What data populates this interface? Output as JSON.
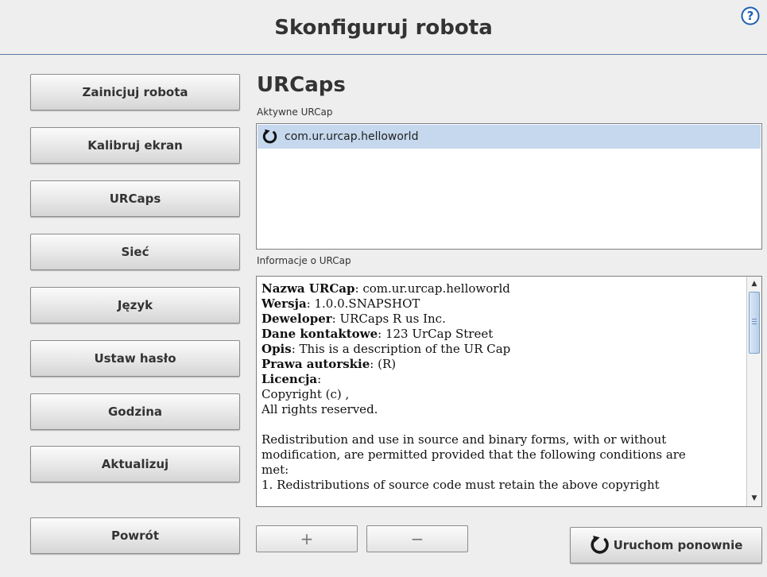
{
  "header": {
    "title": "Skonfiguruj robota",
    "help_icon": "question-mark-circle-icon",
    "help_glyph": "?"
  },
  "nav": {
    "items": [
      {
        "label": "Zainicjuj robota"
      },
      {
        "label": "Kalibruj ekran"
      },
      {
        "label": "URCaps"
      },
      {
        "label": "Sieć"
      },
      {
        "label": "Język"
      },
      {
        "label": "Ustaw hasło"
      },
      {
        "label": "Godzina"
      },
      {
        "label": "Aktualizuj"
      }
    ],
    "back_label": "Powrót"
  },
  "main": {
    "heading": "URCaps",
    "active_label": "Aktywne URCap",
    "active_urcaps": [
      {
        "name": "com.ur.urcap.helloworld",
        "icon": "restart-pending-icon"
      }
    ],
    "info_label": "Informacje o URCap",
    "info": {
      "name_key": "Nazwa URCap",
      "name_val": "com.ur.urcap.helloworld",
      "version_key": "Wersja",
      "version_val": "1.0.0.SNAPSHOT",
      "developer_key": "Deweloper",
      "developer_val": "URCaps R us Inc.",
      "contact_key": "Dane kontaktowe",
      "contact_val": "123 UrCap Street",
      "description_key": "Opis",
      "description_val": "This is a description of the UR Cap",
      "copyright_key": "Prawa autorskie",
      "copyright_val": "(R)",
      "license_key": "Licencja",
      "license_lines": [
        "Copyright (c) ,",
        "All rights reserved.",
        "",
        "Redistribution and use in source and binary forms, with or without",
        "modification, are permitted provided that the following conditions are",
        "met:",
        "1. Redistributions of source code must retain the above copyright"
      ]
    },
    "add_glyph": "+",
    "remove_glyph": "−",
    "restart_label": "Uruchom ponownie"
  },
  "colors": {
    "accent_blue": "#1f5fae",
    "selection": "#c5d8ee",
    "header_rule": "#5a7aa8"
  }
}
